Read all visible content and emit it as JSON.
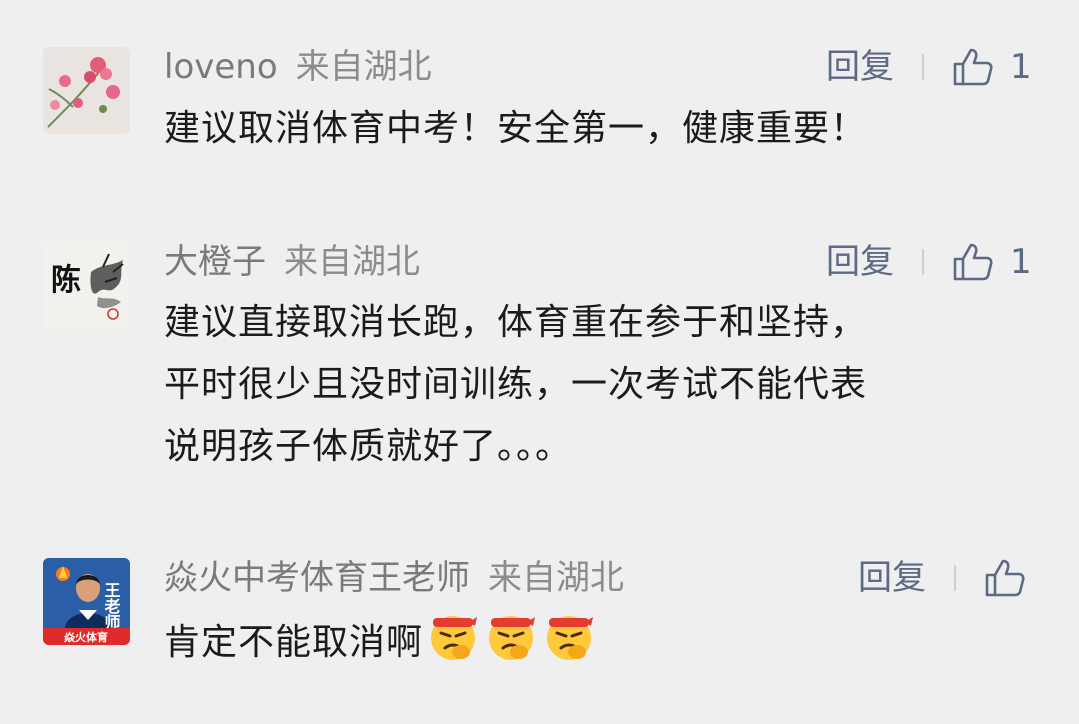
{
  "comments": [
    {
      "user": "loveno",
      "location": "来自湖北",
      "reply_label": "回复",
      "like_count": "1",
      "avatar_icon": "flower-avatar-icon",
      "text_lines": [
        "建议取消体育中考！安全第一，健康重要！"
      ]
    },
    {
      "user": "大橙子",
      "location": "来自湖北",
      "reply_label": "回复",
      "like_count": "1",
      "avatar_icon": "calligraphy-avatar-icon",
      "avatar_glyph": "陈",
      "text_lines": [
        "建议直接取消长跑，体育重在参于和坚持，",
        "平时很少且没时间训练，一次考试不能代表",
        "说明孩子体质就好了。。。"
      ]
    },
    {
      "user": "焱火中考体育王老师",
      "location": "来自湖北",
      "reply_label": "回复",
      "like_count": "",
      "avatar_icon": "teacher-avatar-icon",
      "avatar_side_text": "王老师",
      "avatar_banner_text": "焱火体育",
      "text_lines": [
        "肯定不能取消啊"
      ],
      "emojis": [
        "angry-face-emoji",
        "angry-face-emoji",
        "angry-face-emoji"
      ]
    }
  ],
  "colors": {
    "background": "#efefef",
    "username": "#7a7a7a",
    "action": "#5d6a86",
    "text": "#1b1b1b"
  }
}
